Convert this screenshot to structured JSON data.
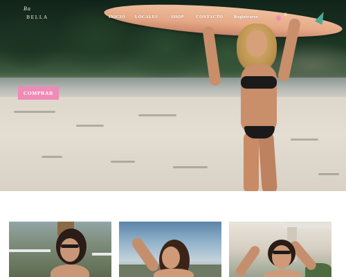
{
  "brand": {
    "logo_script": "Ba",
    "logo_text": "BELLA"
  },
  "nav": {
    "items": [
      {
        "label": "INICIO"
      },
      {
        "label": "LOCALES"
      },
      {
        "label": "SHOP"
      },
      {
        "label": "CONTACTO"
      },
      {
        "label": "Registrarse"
      }
    ],
    "cart_count": "0"
  },
  "hero": {
    "cta_label": "COMPRAR"
  },
  "colors": {
    "accent_pink": "#f08ab6",
    "white": "#ffffff"
  },
  "icons": {
    "cart": "shopping-bag-icon"
  }
}
